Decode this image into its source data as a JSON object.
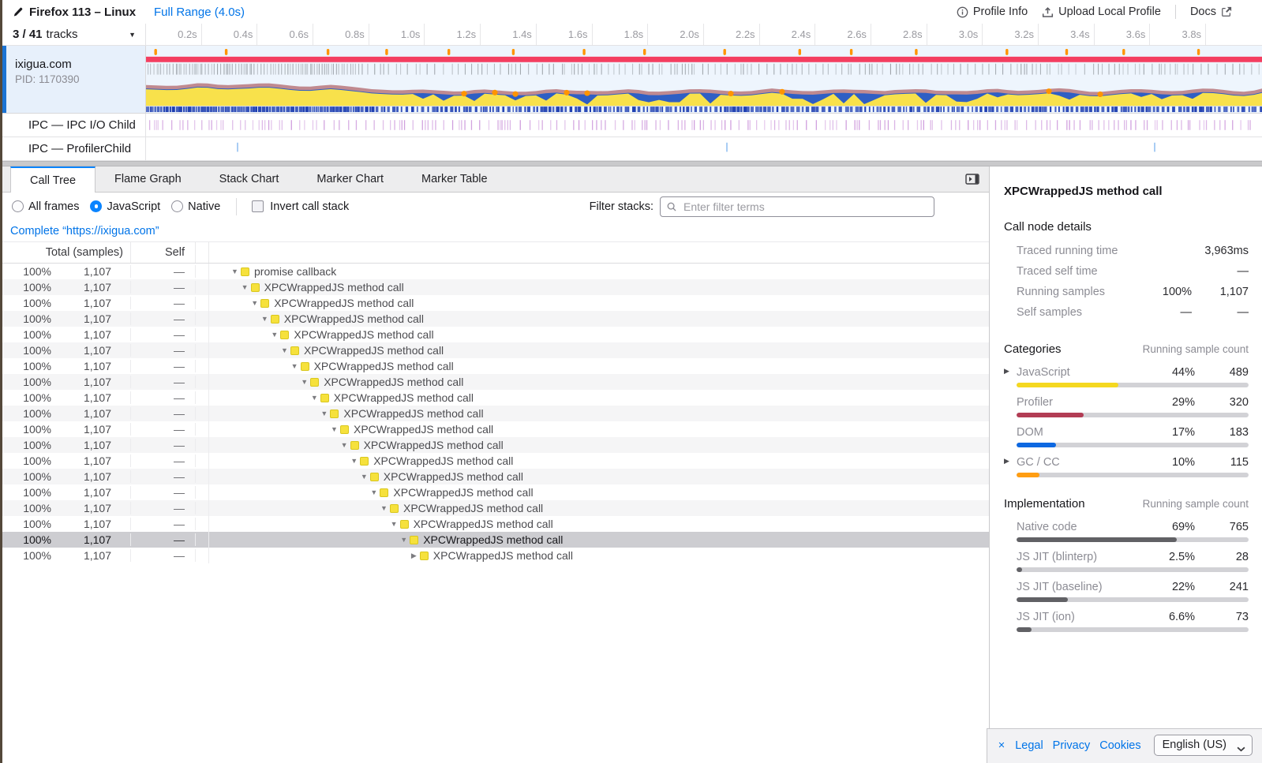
{
  "header": {
    "title": "Firefox 113 – Linux",
    "range_label": "Full Range (4.0s)",
    "actions": {
      "profile_info": "Profile Info",
      "upload": "Upload Local Profile",
      "docs": "Docs"
    }
  },
  "timeline": {
    "summary_bold": "3 / 41",
    "summary_rest": "tracks",
    "ticks": [
      "0.2s",
      "0.4s",
      "0.6s",
      "0.8s",
      "1.0s",
      "1.2s",
      "1.4s",
      "1.6s",
      "1.8s",
      "2.0s",
      "2.2s",
      "2.4s",
      "2.6s",
      "2.8s",
      "3.0s",
      "3.2s",
      "3.4s",
      "3.6s",
      "3.8s"
    ],
    "main_track": {
      "name": "ixigua.com",
      "pid": "PID: 1170390"
    },
    "sub_tracks": [
      "IPC — IPC I/O Child",
      "IPC — ProfilerChild"
    ],
    "colors": {
      "jank": "#ff9400",
      "markers_bar": "#f43e60",
      "tick": "#9aa0a6",
      "mauve": "#c08a90",
      "blue": "#2f5fc4",
      "yellow": "#f8e14b",
      "strip": "#1d3eb0",
      "ipc_tick": "#cf9ddd",
      "profiler_tick": "#a9cdf4",
      "selected_accent": "#1b73d3"
    }
  },
  "tabs": [
    {
      "label": "Call Tree",
      "active": true
    },
    {
      "label": "Flame Graph",
      "active": false
    },
    {
      "label": "Stack Chart",
      "active": false
    },
    {
      "label": "Marker Chart",
      "active": false
    },
    {
      "label": "Marker Table",
      "active": false
    }
  ],
  "filters": {
    "radios": [
      {
        "label": "All frames",
        "selected": false
      },
      {
        "label": "JavaScript",
        "selected": true
      },
      {
        "label": "Native",
        "selected": false
      }
    ],
    "invert_label": "Invert call stack",
    "filter_label": "Filter stacks:",
    "placeholder": "Enter filter terms"
  },
  "breadcrumb": {
    "label": "Complete “https://ixigua.com”"
  },
  "call_tree": {
    "headers": {
      "total": "Total (samples)",
      "self": "Self"
    },
    "rows": [
      {
        "percent": "100%",
        "samples": "1,107",
        "self": "—",
        "label": "promise callback",
        "depth": 0,
        "expanded": true,
        "selected": false
      },
      {
        "percent": "100%",
        "samples": "1,107",
        "self": "—",
        "label": "XPCWrappedJS method call",
        "depth": 1,
        "expanded": true,
        "selected": false
      },
      {
        "percent": "100%",
        "samples": "1,107",
        "self": "—",
        "label": "XPCWrappedJS method call",
        "depth": 2,
        "expanded": true,
        "selected": false
      },
      {
        "percent": "100%",
        "samples": "1,107",
        "self": "—",
        "label": "XPCWrappedJS method call",
        "depth": 3,
        "expanded": true,
        "selected": false
      },
      {
        "percent": "100%",
        "samples": "1,107",
        "self": "—",
        "label": "XPCWrappedJS method call",
        "depth": 4,
        "expanded": true,
        "selected": false
      },
      {
        "percent": "100%",
        "samples": "1,107",
        "self": "—",
        "label": "XPCWrappedJS method call",
        "depth": 5,
        "expanded": true,
        "selected": false
      },
      {
        "percent": "100%",
        "samples": "1,107",
        "self": "—",
        "label": "XPCWrappedJS method call",
        "depth": 6,
        "expanded": true,
        "selected": false
      },
      {
        "percent": "100%",
        "samples": "1,107",
        "self": "—",
        "label": "XPCWrappedJS method call",
        "depth": 7,
        "expanded": true,
        "selected": false
      },
      {
        "percent": "100%",
        "samples": "1,107",
        "self": "—",
        "label": "XPCWrappedJS method call",
        "depth": 8,
        "expanded": true,
        "selected": false
      },
      {
        "percent": "100%",
        "samples": "1,107",
        "self": "—",
        "label": "XPCWrappedJS method call",
        "depth": 9,
        "expanded": true,
        "selected": false
      },
      {
        "percent": "100%",
        "samples": "1,107",
        "self": "—",
        "label": "XPCWrappedJS method call",
        "depth": 10,
        "expanded": true,
        "selected": false
      },
      {
        "percent": "100%",
        "samples": "1,107",
        "self": "—",
        "label": "XPCWrappedJS method call",
        "depth": 11,
        "expanded": true,
        "selected": false
      },
      {
        "percent": "100%",
        "samples": "1,107",
        "self": "—",
        "label": "XPCWrappedJS method call",
        "depth": 12,
        "expanded": true,
        "selected": false
      },
      {
        "percent": "100%",
        "samples": "1,107",
        "self": "—",
        "label": "XPCWrappedJS method call",
        "depth": 13,
        "expanded": true,
        "selected": false
      },
      {
        "percent": "100%",
        "samples": "1,107",
        "self": "—",
        "label": "XPCWrappedJS method call",
        "depth": 14,
        "expanded": true,
        "selected": false
      },
      {
        "percent": "100%",
        "samples": "1,107",
        "self": "—",
        "label": "XPCWrappedJS method call",
        "depth": 15,
        "expanded": true,
        "selected": false
      },
      {
        "percent": "100%",
        "samples": "1,107",
        "self": "—",
        "label": "XPCWrappedJS method call",
        "depth": 16,
        "expanded": true,
        "selected": false
      },
      {
        "percent": "100%",
        "samples": "1,107",
        "self": "—",
        "label": "XPCWrappedJS method call",
        "depth": 17,
        "expanded": true,
        "selected": true
      },
      {
        "percent": "100%",
        "samples": "1,107",
        "self": "—",
        "label": "XPCWrappedJS method call",
        "depth": 18,
        "expanded": false,
        "selected": false
      }
    ]
  },
  "sidebar": {
    "title": "XPCWrappedJS method call",
    "details_header": "Call node details",
    "details": [
      {
        "label": "Traced running time",
        "percent": "",
        "value": "3,963ms"
      },
      {
        "label": "Traced self time",
        "percent": "",
        "value": "—"
      },
      {
        "label": "Running samples",
        "percent": "100%",
        "value": "1,107"
      },
      {
        "label": "Self samples",
        "percent": "—",
        "value": "—"
      }
    ],
    "categories": {
      "title": "Categories",
      "count_header": "Running sample count",
      "rows": [
        {
          "label": "JavaScript",
          "percent": "44%",
          "count": "489",
          "frac": 0.44,
          "color": "#f5d820",
          "expandable": true
        },
        {
          "label": "Profiler",
          "percent": "29%",
          "count": "320",
          "frac": 0.29,
          "color": "#b23c54",
          "expandable": false
        },
        {
          "label": "DOM",
          "percent": "17%",
          "count": "183",
          "frac": 0.17,
          "color": "#0d68e1",
          "expandable": false
        },
        {
          "label": "GC / CC",
          "percent": "10%",
          "count": "115",
          "frac": 0.1,
          "color": "#ff9d12",
          "expandable": true
        }
      ]
    },
    "implementation": {
      "title": "Implementation",
      "count_header": "Running sample count",
      "rows": [
        {
          "label": "Native code",
          "percent": "69%",
          "count": "765",
          "frac": 0.69,
          "color": "#616165",
          "expandable": false
        },
        {
          "label": "JS JIT (blinterp)",
          "percent": "2.5%",
          "count": "28",
          "frac": 0.025,
          "color": "#616165",
          "expandable": false
        },
        {
          "label": "JS JIT (baseline)",
          "percent": "22%",
          "count": "241",
          "frac": 0.22,
          "color": "#616165",
          "expandable": false
        },
        {
          "label": "JS JIT (ion)",
          "percent": "6.6%",
          "count": "73",
          "frac": 0.066,
          "color": "#616165",
          "expandable": false
        }
      ]
    }
  },
  "footer": {
    "close": "×",
    "links": [
      "Legal",
      "Privacy",
      "Cookies"
    ],
    "language": "English (US)"
  }
}
